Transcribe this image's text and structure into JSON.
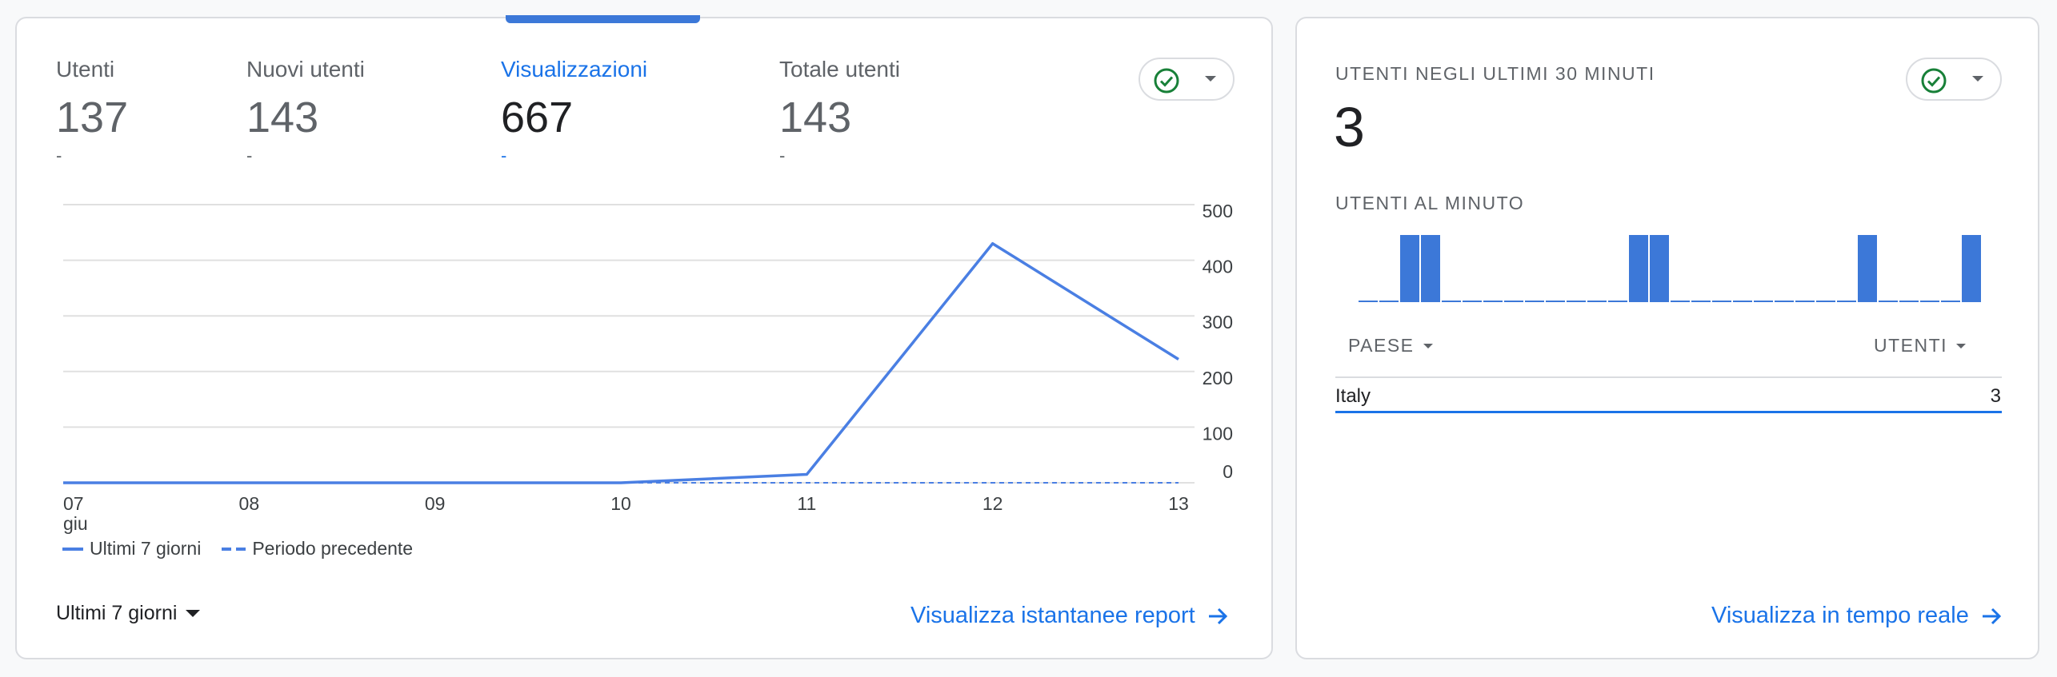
{
  "main_card": {
    "metrics": [
      {
        "label": "Utenti",
        "value": "137",
        "delta": "-"
      },
      {
        "label": "Nuovi utenti",
        "value": "143",
        "delta": "-"
      },
      {
        "label": "Visualizzazioni",
        "value": "667",
        "delta": "-"
      },
      {
        "label": "Totale utenti",
        "value": "143",
        "delta": "-"
      }
    ],
    "active_metric": "Visualizzazioni",
    "date_range_label": "Ultimi 7 giorni",
    "report_link_label": "Visualizza istantanee report"
  },
  "chart_data": {
    "type": "line",
    "x": [
      "07",
      "08",
      "09",
      "10",
      "11",
      "12",
      "13"
    ],
    "x_sublabel": "giu",
    "ylim": [
      0,
      500
    ],
    "yticks": [
      "500",
      "400",
      "300",
      "200",
      "100",
      "0"
    ],
    "grid": true,
    "series": [
      {
        "name": "Ultimi 7 giorni",
        "values": [
          0,
          0,
          0,
          0,
          15,
          430,
          222
        ],
        "style": "solid"
      },
      {
        "name": "Periodo precedente",
        "values": [
          0,
          0,
          0,
          0,
          0,
          0,
          0
        ],
        "style": "dashed"
      }
    ],
    "legend_position": "bottom-left",
    "line_color": "#4a7fe3"
  },
  "realtime_card": {
    "title": "UTENTI NEGLI ULTIMI 30 MINUTI",
    "count": "3",
    "per_minute_title": "UTENTI AL MINUTO",
    "per_minute_bars": [
      0,
      0,
      1,
      1,
      0,
      0,
      0,
      0,
      0,
      0,
      0,
      0,
      0,
      1,
      1,
      0,
      0,
      0,
      0,
      0,
      0,
      0,
      0,
      0,
      1,
      0,
      0,
      0,
      0,
      1,
      0
    ],
    "table": {
      "col_country": "PAESE",
      "col_users": "UTENTI",
      "rows": [
        {
          "country": "Italy",
          "users": "3"
        }
      ]
    },
    "link_label": "Visualizza in tempo reale"
  },
  "colors": {
    "accent": "#1a73e8",
    "chart_line": "#4a7fe3",
    "bar": "#3c78d8",
    "status_ok": "#188038"
  },
  "icons": [
    "check-circle-icon",
    "caret-down-icon",
    "arrow-right-icon"
  ]
}
